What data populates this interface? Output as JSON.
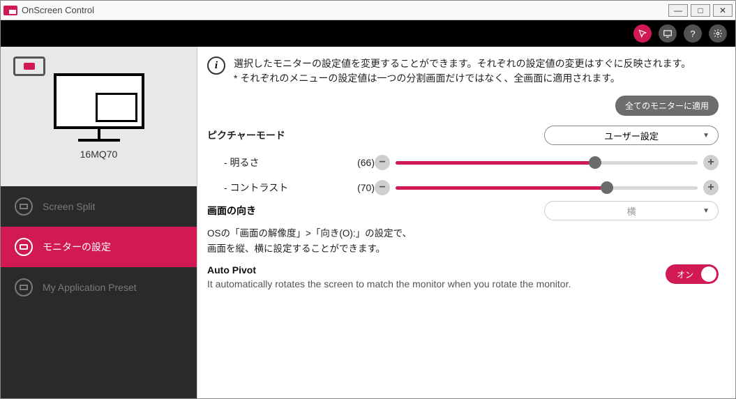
{
  "window": {
    "title": "OnScreen Control"
  },
  "sidebar": {
    "monitor_model": "16MQ70",
    "items": [
      {
        "label": "Screen Split"
      },
      {
        "label": "モニターの設定"
      },
      {
        "label": "My Application Preset"
      }
    ]
  },
  "main": {
    "info_line1": "選択したモニターの設定値を変更することができます。それぞれの設定値の変更はすぐに反映されます。",
    "info_line2": "* それぞれのメニューの設定値は一つの分割画面だけではなく、全画面に適用されます。",
    "apply_all_label": "全てのモニターに適用",
    "picture_mode_label": "ピクチャーモード",
    "picture_mode_value": "ユーザー設定",
    "brightness_label": "- 明るさ",
    "brightness_value_display": "(66)",
    "brightness_value": 66,
    "contrast_label": "- コントラスト",
    "contrast_value_display": "(70)",
    "contrast_value": 70,
    "orientation_label": "画面の向き",
    "orientation_value": "横",
    "orientation_desc_line1": "OSの「画面の解像度」>「向き(O):」の設定で、",
    "orientation_desc_line2": "画面を縦、横に設定することができます。",
    "auto_pivot_title": "Auto Pivot",
    "auto_pivot_desc": "It automatically rotates the screen to match the monitor when you rotate the monitor.",
    "auto_pivot_state": "オン"
  },
  "colors": {
    "accent": "#d11a54"
  }
}
